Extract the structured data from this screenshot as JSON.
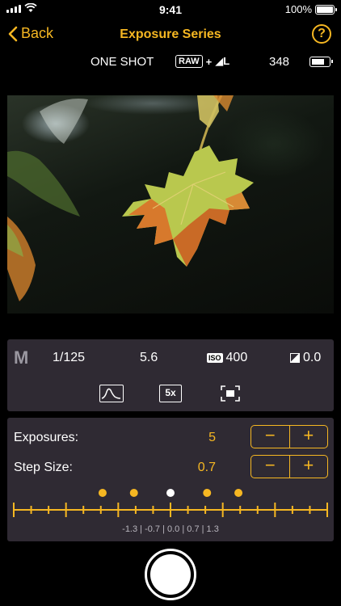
{
  "status_bar": {
    "time": "9:41",
    "battery_percent": "100%"
  },
  "nav": {
    "back_label": "Back",
    "title": "Exposure Series",
    "help_label": "?"
  },
  "camera_info": {
    "drive_mode": "ONE SHOT",
    "format_raw": "RAW",
    "format_plus": "+",
    "format_jpeg": "◢L",
    "shots_remaining": "348",
    "battery_level": 0.66
  },
  "settings": {
    "mode": "M",
    "shutter": "1/125",
    "aperture": "5.6",
    "iso_tag": "ISO",
    "iso": "400",
    "ev": "0.0",
    "zoom_label": "5x",
    "tools": [
      "histogram-icon",
      "zoom-icon",
      "focus-frame-icon"
    ]
  },
  "series": {
    "exposures_label": "Exposures:",
    "exposures_value": "5",
    "step_label": "Step Size:",
    "step_value": "0.7",
    "minus": "−",
    "plus": "+",
    "scale_text": "-1.3 | -0.7 | 0.0 | 0.7 | 1.3",
    "bracket_points": [
      -1.3,
      -0.7,
      0.0,
      0.7,
      1.3
    ],
    "scale_range": [
      -3,
      3
    ],
    "accent": "#f6b722",
    "center_color": "#ffffff"
  }
}
